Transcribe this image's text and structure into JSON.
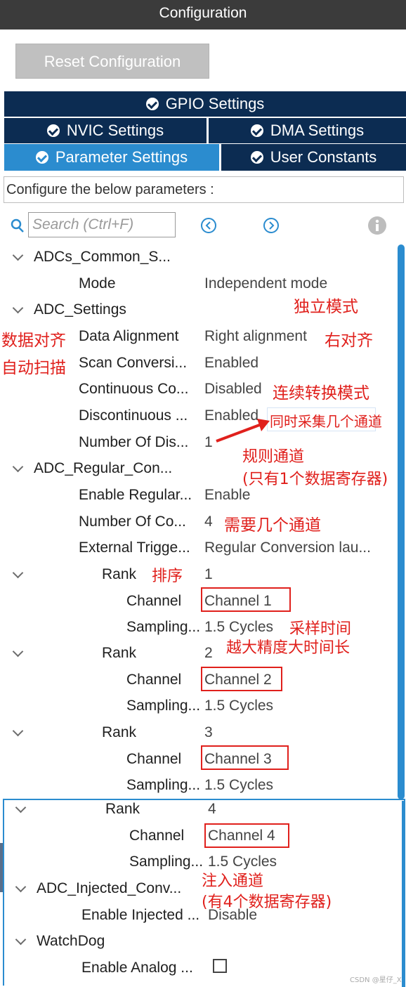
{
  "header": {
    "title": "Configuration"
  },
  "reset_button": "Reset Configuration",
  "tabs": {
    "gpio": "GPIO Settings",
    "nvic": "NVIC Settings",
    "dma": "DMA Settings",
    "parameter": "Parameter Settings",
    "user_constants": "User Constants"
  },
  "config_label": "Configure the below parameters :",
  "search": {
    "placeholder": "Search (Ctrl+F)"
  },
  "tree": {
    "adcs_common": "ADCs_Common_S...",
    "mode": {
      "label": "Mode",
      "value": "Independent mode"
    },
    "adc_settings": "ADC_Settings",
    "data_alignment": {
      "label": "Data Alignment",
      "value": "Right alignment"
    },
    "scan_conversion": {
      "label": "Scan Conversi...",
      "value": "Enabled"
    },
    "continuous": {
      "label": "Continuous Co...",
      "value": "Disabled"
    },
    "discontinuous": {
      "label": "Discontinuous ...",
      "value": "Enabled"
    },
    "number_of_dis": {
      "label": "Number Of Dis...",
      "value": "1"
    },
    "adc_regular": "ADC_Regular_Con...",
    "enable_regular": {
      "label": "Enable Regular...",
      "value": "Enable"
    },
    "number_of_conv": {
      "label": "Number Of Co...",
      "value": "4"
    },
    "external_trigger": {
      "label": "External Trigge...",
      "value": "Regular Conversion lau..."
    },
    "ranks": [
      {
        "label": "Rank",
        "value": "1",
        "channel_label": "Channel",
        "channel": "Channel 1",
        "sampling_label": "Sampling...",
        "sampling": "1.5 Cycles"
      },
      {
        "label": "Rank",
        "value": "2",
        "channel_label": "Channel",
        "channel": "Channel 2",
        "sampling_label": "Sampling...",
        "sampling": "1.5 Cycles"
      },
      {
        "label": "Rank",
        "value": "3",
        "channel_label": "Channel",
        "channel": "Channel 3",
        "sampling_label": "Sampling...",
        "sampling": "1.5 Cycles"
      },
      {
        "label": "Rank",
        "value": "4",
        "channel_label": "Channel",
        "channel": "Channel 4",
        "sampling_label": "Sampling...",
        "sampling": "1.5 Cycles"
      }
    ],
    "adc_injected": "ADC_Injected_Conv...",
    "enable_injected": {
      "label": "Enable Injected ...",
      "value": "Disable"
    },
    "watchdog": "WatchDog",
    "enable_analog": {
      "label": "Enable Analog ..."
    }
  },
  "annotations": {
    "independent_mode": "独立模式",
    "data_alignment": "数据对齐",
    "right_alignment": "右对齐",
    "auto_scan": "自动扫描",
    "continuous_mode": "连续转换模式",
    "simultaneous": "同时采集几个通道",
    "regular_channel": "规则通道",
    "regular_channel_note": "(只有1个数据寄存器)",
    "how_many_channels": "需要几个通道",
    "sort": "排序",
    "sampling_time": "采样时间",
    "sampling_note": "越大精度大时间长",
    "injected_channel": "注入通道",
    "injected_note": "(有4个数据寄存器)"
  },
  "watermark": "CSDN @星仔_X",
  "colors": {
    "header_bg": "#3b3b3b",
    "tab_bg": "#0c2c52",
    "tab_active": "#2b8ccf",
    "annotation_red": "#e0201c"
  }
}
